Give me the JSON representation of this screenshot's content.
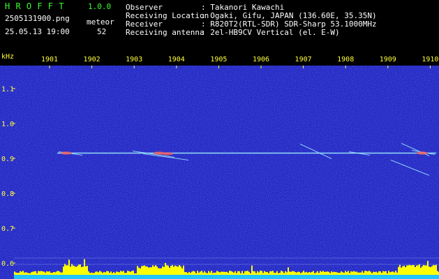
{
  "header": {
    "app_name": "H R O F F T",
    "app_version": "1.0.0",
    "filename": "2505131900.png",
    "datetime": "25.05.13 19:00",
    "detection_label": "meteor",
    "detection_count": "52",
    "info": [
      {
        "label": "Observer",
        "value": ": Takanori Kawachi"
      },
      {
        "label": "Receiving Location",
        "value": ": Ogaki, Gifu, JAPAN (136.60E, 35.35N)"
      },
      {
        "label": "Receiver",
        "value": ": R820T2(RTL-SDR) SDR-Sharp 53.1000MHz"
      },
      {
        "label": "Receiving antenna",
        "value": ": 2el-HB9CV Vertical (el. E-W)"
      }
    ]
  },
  "chart_data": {
    "type": "heatmap",
    "ylabel": "kHz",
    "x_ticks": [
      "1901",
      "1902",
      "1903",
      "1904",
      "1905",
      "1906",
      "1907",
      "1908",
      "1909",
      "1910"
    ],
    "y_ticks": [
      "1.1",
      "1.0",
      "0.9",
      "0.8",
      "0.7",
      "0.6"
    ],
    "y_tick_values": [
      1.1,
      1.0,
      0.9,
      0.8,
      0.7,
      0.6
    ],
    "ylim": [
      0.59,
      1.18
    ],
    "carrier_khz": 0.915,
    "colors": {
      "background": "#1a1fb4",
      "axis_text": "#ffff3a",
      "carrier": "#9ff0ff",
      "meteor_head": "#ff5a50",
      "level_fill": "#ffff00",
      "level_base": "#22c4ff"
    }
  }
}
